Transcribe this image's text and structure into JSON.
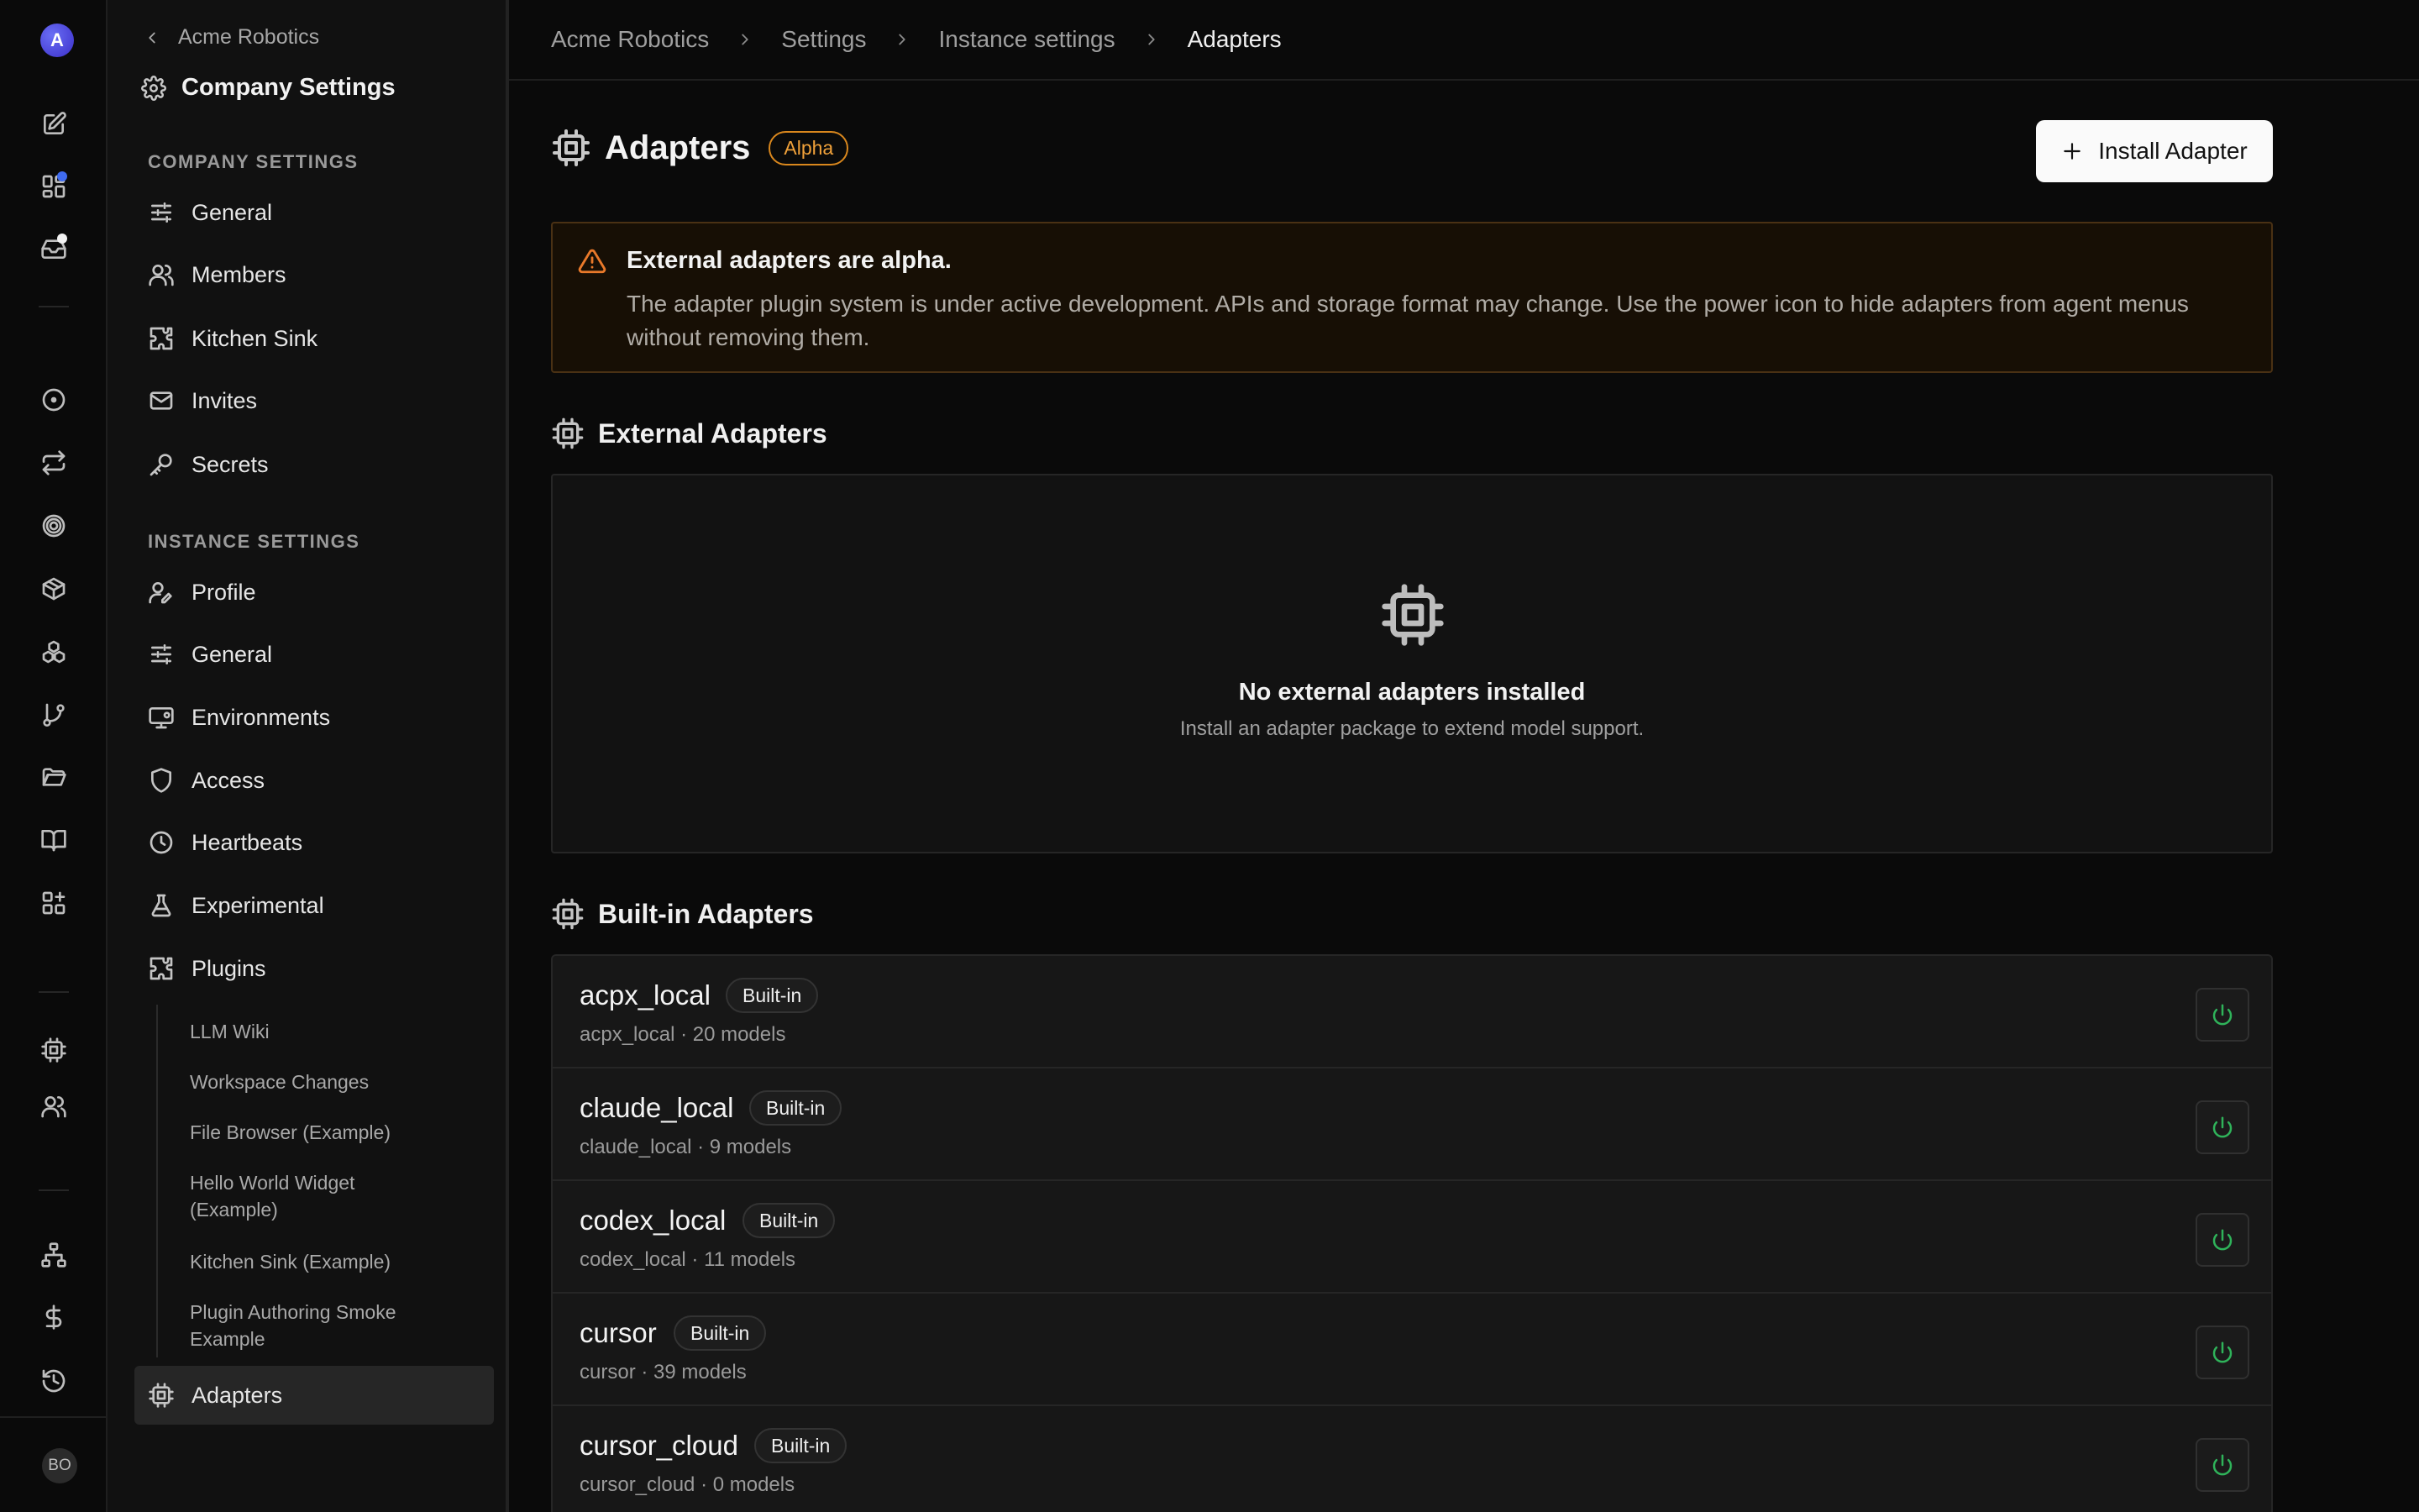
{
  "app": {
    "workspace_initial": "A",
    "user_initials": "BO",
    "accent": "#3f6bf0",
    "warning_color": "#e9792a",
    "success_color": "#2fb35a"
  },
  "rail": {
    "icons": [
      "compose-icon",
      "dashboard-icon",
      "inbox-icon",
      "circle-dot-icon",
      "swap-icon",
      "target-icon",
      "package-icon",
      "cubes-icon",
      "branch-icon",
      "folder-icon",
      "book-icon",
      "apps-icon",
      "chip-icon",
      "users-icon",
      "org-chart-icon",
      "dollar-icon",
      "history-icon"
    ]
  },
  "sidebar": {
    "back_label": "Acme Robotics",
    "title": "Company Settings",
    "company_section": "COMPANY SETTINGS",
    "company_items": [
      {
        "label": "General",
        "icon": "sliders-icon"
      },
      {
        "label": "Members",
        "icon": "users-icon"
      },
      {
        "label": "Kitchen Sink",
        "icon": "puzzle-icon"
      },
      {
        "label": "Invites",
        "icon": "mail-icon"
      },
      {
        "label": "Secrets",
        "icon": "key-icon"
      }
    ],
    "instance_section": "INSTANCE SETTINGS",
    "instance_items": [
      {
        "label": "Profile",
        "icon": "user-edit-icon"
      },
      {
        "label": "General",
        "icon": "sliders-icon"
      },
      {
        "label": "Environments",
        "icon": "monitor-icon"
      },
      {
        "label": "Access",
        "icon": "shield-icon"
      },
      {
        "label": "Heartbeats",
        "icon": "clock-icon"
      },
      {
        "label": "Experimental",
        "icon": "flask-icon"
      },
      {
        "label": "Plugins",
        "icon": "puzzle-icon"
      }
    ],
    "plugin_items": [
      "LLM Wiki",
      "Workspace Changes",
      "File Browser (Example)",
      "Hello World Widget (Example)",
      "Kitchen Sink (Example)",
      "Plugin Authoring Smoke Example"
    ],
    "active_item": {
      "label": "Adapters",
      "icon": "chip-icon"
    }
  },
  "breadcrumb": [
    "Acme Robotics",
    "Settings",
    "Instance settings",
    "Adapters"
  ],
  "header": {
    "title": "Adapters",
    "badge": "Alpha",
    "install_button": "Install Adapter"
  },
  "alert": {
    "title": "External adapters are alpha.",
    "body": "The adapter plugin system is under active development. APIs and storage format may change. Use the power icon to hide adapters from agent menus without removing them."
  },
  "external": {
    "heading": "External Adapters",
    "empty_title": "No external adapters installed",
    "empty_subtitle": "Install an adapter package to extend model support."
  },
  "builtin": {
    "heading": "Built-in Adapters",
    "badge": "Built-in",
    "adapters": [
      {
        "name": "acpx_local",
        "meta": "acpx_local · 20 models"
      },
      {
        "name": "claude_local",
        "meta": "claude_local · 9 models"
      },
      {
        "name": "codex_local",
        "meta": "codex_local · 11 models"
      },
      {
        "name": "cursor",
        "meta": "cursor · 39 models"
      },
      {
        "name": "cursor_cloud",
        "meta": "cursor_cloud · 0 models"
      }
    ]
  }
}
